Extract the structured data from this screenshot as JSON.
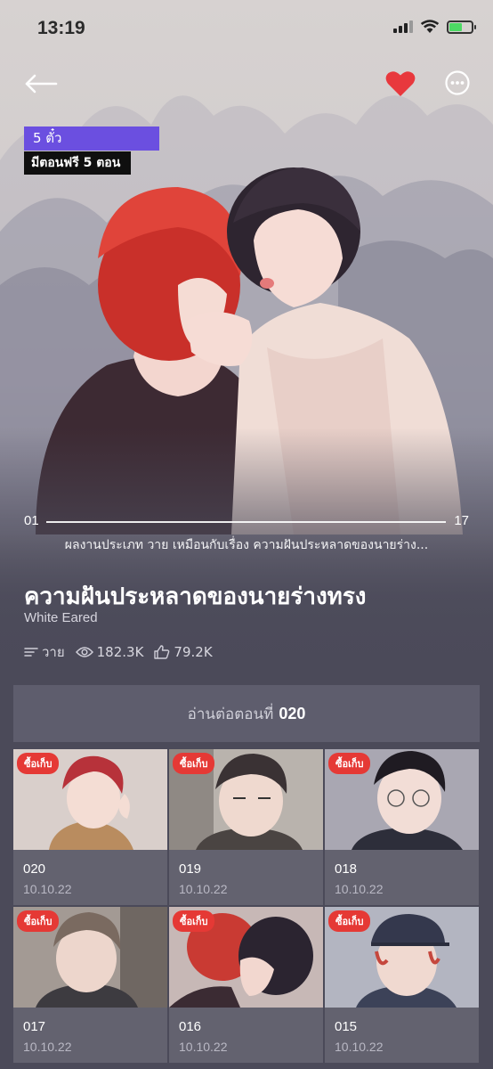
{
  "status_bar": {
    "time": "13:19"
  },
  "header": {
    "back_icon": "arrow-left-icon",
    "favorite_icon": "heart-icon",
    "favorite_color": "#e8383d",
    "more_icon": "more-dots-icon"
  },
  "badges": {
    "price": "5 ตั๋ว",
    "price_color": "#6b4fe0",
    "free": "มีตอนฟรี 5 ตอน"
  },
  "progress": {
    "start": "01",
    "end": "17"
  },
  "genre_line": "ผลงานประเภท วาย เหมือนกับเรื่อง ความฝันประหลาดของนายร่าง...",
  "title": "ความฝันประหลาดของนายร่างทรง",
  "author": "White Eared",
  "stats": {
    "genre": "วาย",
    "views": "182.3K",
    "likes": "79.2K"
  },
  "continue": {
    "label": "อ่านต่อตอนที่",
    "episode": "020"
  },
  "episodes": [
    {
      "number": "020",
      "date": "10.10.22",
      "badge": "ซื้อเก็บ"
    },
    {
      "number": "019",
      "date": "10.10.22",
      "badge": "ซื้อเก็บ"
    },
    {
      "number": "018",
      "date": "10.10.22",
      "badge": "ซื้อเก็บ"
    },
    {
      "number": "017",
      "date": "10.10.22",
      "badge": "ซื้อเก็บ"
    },
    {
      "number": "016",
      "date": "10.10.22",
      "badge": "ซื้อเก็บ"
    },
    {
      "number": "015",
      "date": "10.10.22",
      "badge": "ซื้อเก็บ"
    }
  ]
}
